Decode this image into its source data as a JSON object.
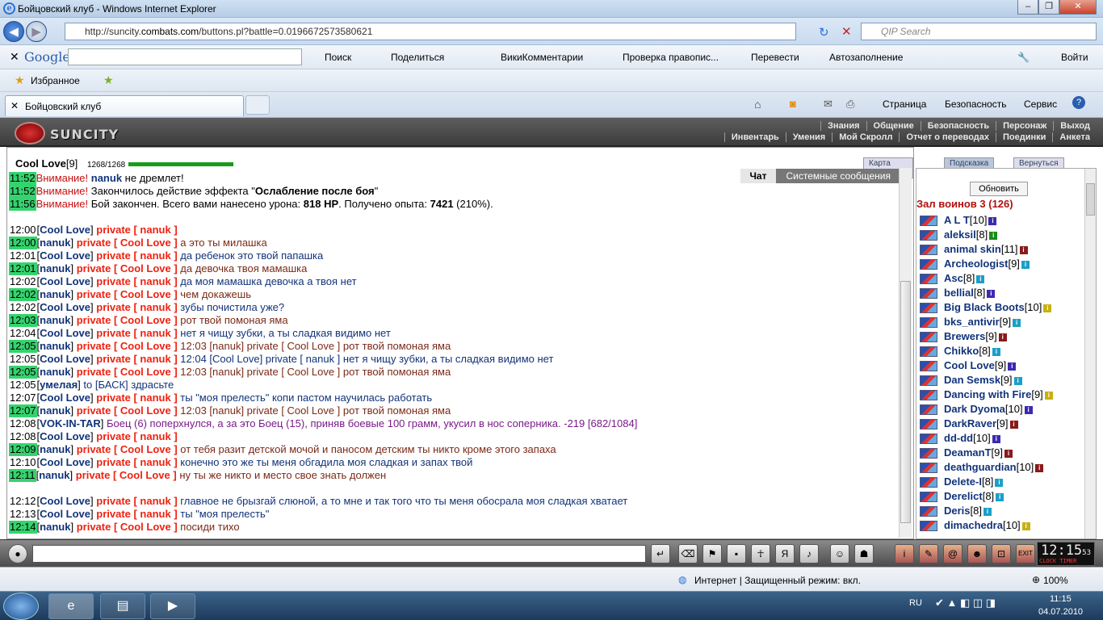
{
  "window": {
    "title": "Бойцовский клуб - Windows Internet Explorer"
  },
  "address": {
    "url_pre": "http://suncity.",
    "url_host": "combats.com",
    "url_post": "/buttons.pl?battle=0.0196672573580621",
    "search_placeholder": "QIP Search"
  },
  "google_bar": {
    "logo": "Google",
    "search": "Поиск",
    "share": "Поделиться",
    "wiki": "ВикиКомментарии",
    "spell": "Проверка правопис...",
    "translate": "Перевести",
    "autofill": "Автозаполнение",
    "login": "Войти"
  },
  "favorites": {
    "label": "Избранное"
  },
  "tab": {
    "label": "Бойцовский клуб"
  },
  "ie_cmd": {
    "page": "Страница",
    "security": "Безопасность",
    "service": "Сервис"
  },
  "game": {
    "logo": "SUNCITY",
    "menu_top": [
      "Знания",
      "Общение",
      "Безопасность",
      "Персонаж",
      "Выход"
    ],
    "menu_bottom": [
      "Инвентарь",
      "Умения",
      "Мой Скролл",
      "Отчет о переводах",
      "Поединки",
      "Анкета"
    ],
    "player": {
      "name": "Cool Love",
      "level": "[9]",
      "hp": "1268/1268"
    },
    "top_buttons": [
      "Карта миров",
      "Подсказка",
      "Вернуться"
    ],
    "chat_tabs": [
      "Чат",
      "Системные сообщения"
    ],
    "refresh": "Обновить",
    "hall": "Зал воинов 3 (126)"
  },
  "chat_lines": [
    {
      "time": "11:52",
      "hl": true,
      "parts": [
        [
          "warn",
          "Внимание! "
        ],
        [
          "nm",
          "nanuk"
        ],
        [
          "msg",
          " не дремлет!"
        ]
      ]
    },
    {
      "time": "11:52",
      "hl": true,
      "parts": [
        [
          "warn",
          "Внимание! "
        ],
        [
          "msg",
          "Закончилось действие эффекта \""
        ],
        [
          "nmb",
          "Ослабление после боя"
        ],
        [
          "msg",
          "\""
        ]
      ]
    },
    {
      "time": "11:56",
      "hl": true,
      "parts": [
        [
          "warn",
          "Внимание! "
        ],
        [
          "msg",
          "Бой закончен. Всего вами нанесено урона: "
        ],
        [
          "nmb",
          "818 HP"
        ],
        [
          "msg",
          ". Получено опыта: "
        ],
        [
          "nmb",
          "7421"
        ],
        [
          "msg",
          " (210%)."
        ]
      ]
    },
    {
      "time": "",
      "hl": false,
      "parts": []
    },
    {
      "time": "12:00",
      "hl": false,
      "parts": [
        [
          "br",
          "["
        ],
        [
          "nm",
          "Cool Love"
        ],
        [
          "br",
          "] "
        ],
        [
          "pvu",
          "private [ nanuk ]"
        ]
      ]
    },
    {
      "time": "12:00",
      "hl": true,
      "parts": [
        [
          "br",
          "["
        ],
        [
          "nm",
          "nanuk"
        ],
        [
          "br",
          "] "
        ],
        [
          "pvu",
          "private [ Cool Love ]"
        ],
        [
          "msgr",
          " а это ты милашка"
        ]
      ]
    },
    {
      "time": "12:01",
      "hl": false,
      "parts": [
        [
          "br",
          "["
        ],
        [
          "nm",
          "Cool Love"
        ],
        [
          "br",
          "] "
        ],
        [
          "pvu",
          "private [ nanuk ]"
        ],
        [
          "msgn",
          " да ребенок это твой папашка"
        ]
      ]
    },
    {
      "time": "12:01",
      "hl": true,
      "parts": [
        [
          "br",
          "["
        ],
        [
          "nm",
          "nanuk"
        ],
        [
          "br",
          "] "
        ],
        [
          "pvu",
          "private [ Cool Love ]"
        ],
        [
          "msgr",
          " да девочка твоя мамашка"
        ]
      ]
    },
    {
      "time": "12:02",
      "hl": false,
      "parts": [
        [
          "br",
          "["
        ],
        [
          "nm",
          "Cool Love"
        ],
        [
          "br",
          "] "
        ],
        [
          "pvu",
          "private [ nanuk ]"
        ],
        [
          "msgn",
          " да моя мамашка девочка а твоя нет"
        ]
      ]
    },
    {
      "time": "12:02",
      "hl": true,
      "parts": [
        [
          "br",
          "["
        ],
        [
          "nm",
          "nanuk"
        ],
        [
          "br",
          "] "
        ],
        [
          "pvu",
          "private [ Cool Love ]"
        ],
        [
          "msgr",
          " чем докажешь"
        ]
      ]
    },
    {
      "time": "12:02",
      "hl": false,
      "parts": [
        [
          "br",
          "["
        ],
        [
          "nm",
          "Cool Love"
        ],
        [
          "br",
          "] "
        ],
        [
          "pvu",
          "private [ nanuk ]"
        ],
        [
          "msgn",
          " зубы почистила уже?"
        ]
      ]
    },
    {
      "time": "12:03",
      "hl": true,
      "parts": [
        [
          "br",
          "["
        ],
        [
          "nm",
          "nanuk"
        ],
        [
          "br",
          "] "
        ],
        [
          "pvu",
          "private [ Cool Love ]"
        ],
        [
          "msgr",
          " рот твой помоная яма"
        ]
      ]
    },
    {
      "time": "12:04",
      "hl": false,
      "parts": [
        [
          "br",
          "["
        ],
        [
          "nm",
          "Cool Love"
        ],
        [
          "br",
          "] "
        ],
        [
          "pvu",
          "private [ nanuk ]"
        ],
        [
          "msgn",
          " нет я чищу зубки, а ты сладкая видимо нет"
        ]
      ]
    },
    {
      "time": "12:05",
      "hl": true,
      "parts": [
        [
          "br",
          "["
        ],
        [
          "nm",
          "nanuk"
        ],
        [
          "br",
          "] "
        ],
        [
          "pvu",
          "private [ Cool Love ]"
        ],
        [
          "msgr",
          " 12:03 [nanuk] private [ Cool Love ] рот твой помоная яма"
        ]
      ]
    },
    {
      "time": "12:05",
      "hl": false,
      "parts": [
        [
          "br",
          "["
        ],
        [
          "nm",
          "Cool Love"
        ],
        [
          "br",
          "] "
        ],
        [
          "pvu",
          "private [ nanuk ]"
        ],
        [
          "msgn",
          " 12:04 [Cool Love] private [ nanuk ] нет я чищу зубки, а ты сладкая видимо нет"
        ]
      ]
    },
    {
      "time": "12:05",
      "hl": true,
      "parts": [
        [
          "br",
          "["
        ],
        [
          "nm",
          "nanuk"
        ],
        [
          "br",
          "] "
        ],
        [
          "pvu",
          "private [ Cool Love ]"
        ],
        [
          "msgr",
          " 12:03 [nanuk] private [ Cool Love ] рот твой помоная яма"
        ]
      ]
    },
    {
      "time": "12:05",
      "hl": false,
      "parts": [
        [
          "br",
          "["
        ],
        [
          "nm",
          "умелая"
        ],
        [
          "br",
          "] "
        ],
        [
          "nm2",
          "to [БАСК] здрасьте"
        ]
      ]
    },
    {
      "time": "12:07",
      "hl": false,
      "parts": [
        [
          "br",
          "["
        ],
        [
          "nm",
          "Cool Love"
        ],
        [
          "br",
          "] "
        ],
        [
          "pvu",
          "private [ nanuk ]"
        ],
        [
          "msgn",
          " ты \"моя прелесть\" копи пастом научилась работать"
        ]
      ]
    },
    {
      "time": "12:07",
      "hl": true,
      "parts": [
        [
          "br",
          "["
        ],
        [
          "nm",
          "nanuk"
        ],
        [
          "br",
          "] "
        ],
        [
          "pvu",
          "private [ Cool Love ]"
        ],
        [
          "msgr",
          " 12:03 [nanuk] private [ Cool Love ] рот твой помоная яма"
        ]
      ]
    },
    {
      "time": "12:08",
      "hl": false,
      "parts": [
        [
          "br",
          "["
        ],
        [
          "nm",
          "VOK-IN-TAR"
        ],
        [
          "br",
          "] "
        ],
        [
          "sys",
          "Боец (6) поперхнулся, а за это Боец (15), приняв боевые 100 грамм, укусил в нос соперника. -219 [682/1084]"
        ]
      ]
    },
    {
      "time": "12:08",
      "hl": false,
      "parts": [
        [
          "br",
          "["
        ],
        [
          "nm",
          "Cool Love"
        ],
        [
          "br",
          "] "
        ],
        [
          "pvu",
          "private [ nanuk ]"
        ]
      ]
    },
    {
      "time": "12:09",
      "hl": true,
      "parts": [
        [
          "br",
          "["
        ],
        [
          "nm",
          "nanuk"
        ],
        [
          "br",
          "] "
        ],
        [
          "pvu",
          "private [ Cool Love ]"
        ],
        [
          "msgr",
          " от тебя разит детской мочой и паносом детским ты никто кроме этого запаха"
        ]
      ]
    },
    {
      "time": "12:10",
      "hl": false,
      "parts": [
        [
          "br",
          "["
        ],
        [
          "nm",
          "Cool Love"
        ],
        [
          "br",
          "] "
        ],
        [
          "pvu",
          "private [ nanuk ]"
        ],
        [
          "msgn",
          " конечно это же ты меня обгадила моя сладкая и запах твой"
        ]
      ]
    },
    {
      "time": "12:11",
      "hl": true,
      "parts": [
        [
          "br",
          "["
        ],
        [
          "nm",
          "nanuk"
        ],
        [
          "br",
          "] "
        ],
        [
          "pvu",
          "private [ Cool Love ]"
        ],
        [
          "msgr",
          " ну ты же никто и место свое знать должен"
        ]
      ]
    },
    {
      "time": "",
      "hl": false,
      "parts": []
    },
    {
      "time": "12:12",
      "hl": false,
      "parts": [
        [
          "br",
          "["
        ],
        [
          "nm",
          "Cool Love"
        ],
        [
          "br",
          "] "
        ],
        [
          "pvu",
          "private [ nanuk ]"
        ],
        [
          "msgn",
          " главное не брызгай слюной, а то мне и так того что ты меня обосрала моя сладкая хватает"
        ]
      ]
    },
    {
      "time": "12:13",
      "hl": false,
      "parts": [
        [
          "br",
          "["
        ],
        [
          "nm",
          "Cool Love"
        ],
        [
          "br",
          "] "
        ],
        [
          "pvu",
          "private [ nanuk ]"
        ],
        [
          "msgn",
          " ты \"моя прелесть\""
        ]
      ]
    },
    {
      "time": "12:14",
      "hl": true,
      "parts": [
        [
          "br",
          "["
        ],
        [
          "nm",
          "nanuk"
        ],
        [
          "br",
          "] "
        ],
        [
          "pvu",
          "private [ Cool Love ]"
        ],
        [
          "msgr",
          " посиди тихо"
        ]
      ]
    }
  ],
  "players": [
    {
      "name": "A L T",
      "lvl": "[10]",
      "c": "#3b2ab0"
    },
    {
      "name": "aleksil",
      "lvl": "[8]",
      "c": "#1a8a1a"
    },
    {
      "name": "animal skin",
      "lvl": "[11]",
      "c": "#8a1a1a"
    },
    {
      "name": "Archeologist",
      "lvl": "[9]",
      "c": "#1aa0c8"
    },
    {
      "name": "Asc",
      "lvl": "[8]",
      "c": "#1aa0c8"
    },
    {
      "name": "bellial",
      "lvl": "[8]",
      "c": "#3b2ab0"
    },
    {
      "name": "Big Black Boots",
      "lvl": "[10]",
      "c": "#c8b010"
    },
    {
      "name": "bks_antivir",
      "lvl": "[9]",
      "c": "#1aa0c8"
    },
    {
      "name": "Brewers",
      "lvl": "[9]",
      "c": "#8a1a1a"
    },
    {
      "name": "Chikko",
      "lvl": "[8]",
      "c": "#1aa0c8"
    },
    {
      "name": "Cool Love",
      "lvl": "[9]",
      "c": "#3b2ab0"
    },
    {
      "name": "Dan Semsk",
      "lvl": "[9]",
      "c": "#1aa0c8"
    },
    {
      "name": "Dancing with Fire",
      "lvl": "[9]",
      "c": "#c8b010"
    },
    {
      "name": "Dark Dyoma",
      "lvl": "[10]",
      "c": "#3b2ab0"
    },
    {
      "name": "DarkRaver",
      "lvl": "[9]",
      "c": "#8a1a1a"
    },
    {
      "name": "dd-dd",
      "lvl": "[10]",
      "c": "#3b2ab0"
    },
    {
      "name": "DeamanT",
      "lvl": "[9]",
      "c": "#8a1a1a"
    },
    {
      "name": "deathguardian",
      "lvl": "[10]",
      "c": "#8a1a1a"
    },
    {
      "name": "Delete-I",
      "lvl": "[8]",
      "c": "#1aa0c8"
    },
    {
      "name": "Derelict",
      "lvl": "[8]",
      "c": "#1aa0c8"
    },
    {
      "name": "Deris",
      "lvl": "[8]",
      "c": "#1aa0c8"
    },
    {
      "name": "dimachedra",
      "lvl": "[10]",
      "c": "#c8b010"
    }
  ],
  "status": {
    "zone": "Интернет | Защищенный режим: вкл.",
    "zoom": "100%"
  },
  "clock": {
    "time": "12:15",
    "sec": "53",
    "labels": "CLOCK TIMER"
  },
  "taskbar": {
    "lang": "RU",
    "time": "11:15",
    "date": "04.07.2010"
  }
}
